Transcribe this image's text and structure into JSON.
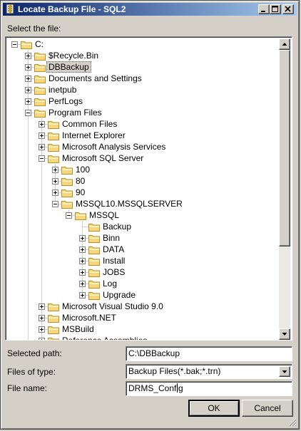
{
  "window": {
    "title": "Locate Backup File - SQL2",
    "controls": [
      "minimize",
      "maximize",
      "close"
    ]
  },
  "labels": {
    "select_file": "Select the file:",
    "selected_path": "Selected path:",
    "files_of_type": "Files of type:",
    "file_name": "File name:"
  },
  "tree": [
    {
      "label": "C:",
      "level": 0,
      "expander": "minus"
    },
    {
      "label": "$Recycle.Bin",
      "level": 1,
      "expander": "plus"
    },
    {
      "label": "DBBackup",
      "level": 1,
      "expander": "plus",
      "selected": true
    },
    {
      "label": "Documents and Settings",
      "level": 1,
      "expander": "plus"
    },
    {
      "label": "inetpub",
      "level": 1,
      "expander": "plus"
    },
    {
      "label": "PerfLogs",
      "level": 1,
      "expander": "plus"
    },
    {
      "label": "Program Files",
      "level": 1,
      "expander": "minus"
    },
    {
      "label": "Common Files",
      "level": 2,
      "expander": "plus"
    },
    {
      "label": "Internet Explorer",
      "level": 2,
      "expander": "plus"
    },
    {
      "label": "Microsoft Analysis Services",
      "level": 2,
      "expander": "plus"
    },
    {
      "label": "Microsoft SQL Server",
      "level": 2,
      "expander": "minus"
    },
    {
      "label": "100",
      "level": 3,
      "expander": "plus"
    },
    {
      "label": "80",
      "level": 3,
      "expander": "plus"
    },
    {
      "label": "90",
      "level": 3,
      "expander": "plus"
    },
    {
      "label": "MSSQL10.MSSQLSERVER",
      "level": 3,
      "expander": "minus"
    },
    {
      "label": "MSSQL",
      "level": 4,
      "expander": "minus"
    },
    {
      "label": "Backup",
      "level": 5,
      "expander": "none"
    },
    {
      "label": "Binn",
      "level": 5,
      "expander": "plus"
    },
    {
      "label": "DATA",
      "level": 5,
      "expander": "plus"
    },
    {
      "label": "Install",
      "level": 5,
      "expander": "plus"
    },
    {
      "label": "JOBS",
      "level": 5,
      "expander": "plus"
    },
    {
      "label": "Log",
      "level": 5,
      "expander": "plus"
    },
    {
      "label": "Upgrade",
      "level": 5,
      "expander": "plus"
    },
    {
      "label": "Microsoft Visual Studio 9.0",
      "level": 2,
      "expander": "plus"
    },
    {
      "label": "Microsoft.NET",
      "level": 2,
      "expander": "plus"
    },
    {
      "label": "MSBuild",
      "level": 2,
      "expander": "plus"
    },
    {
      "label": "Reference Assemblies",
      "level": 2,
      "expander": "plus"
    }
  ],
  "selected_path": "C:\\DBBackup",
  "files_of_type": "Backup Files(*.bak;*.trn)",
  "file_name": "DRMS_Config",
  "buttons": {
    "ok": "OK",
    "cancel": "Cancel"
  },
  "colors": {
    "title_start": "#0a246a",
    "title_end": "#a6caf0",
    "folder": "#f7d77a",
    "folder_edge": "#b8902a",
    "selection": "#d4d0c8"
  }
}
